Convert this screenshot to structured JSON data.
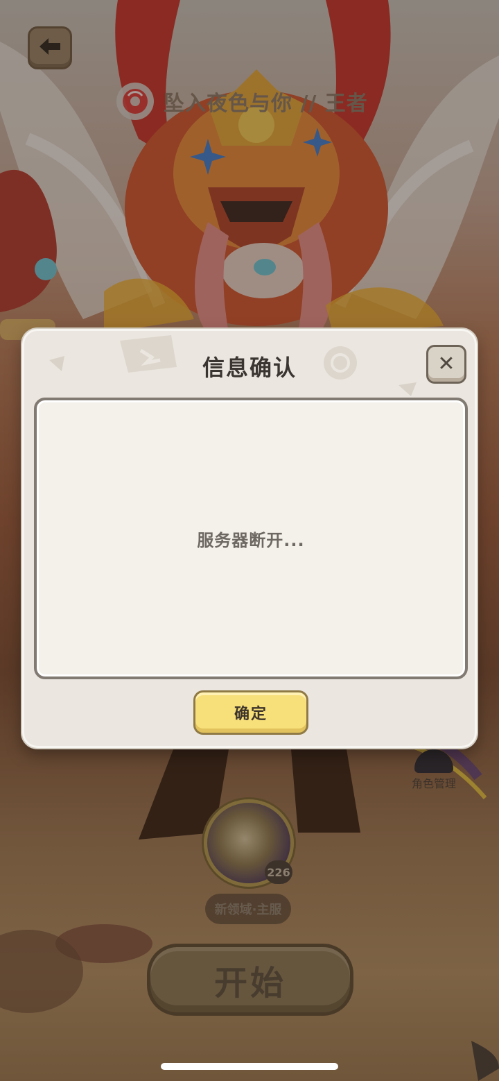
{
  "background": {
    "song_title": "坠入夜色与你 // 王者",
    "role_management_label": "角色管理",
    "avatar_level": "226",
    "server_name": "新领域·主服",
    "start_label": "开始"
  },
  "dialog": {
    "title": "信息确认",
    "message": "服务器断开...",
    "confirm_label": "确定",
    "close_glyph": "✕"
  },
  "colors": {
    "dialog_bg": "#ebe6df",
    "confirm_button": "#f7df7a",
    "scene_overlay": "rgba(40,30,20,0.38)"
  },
  "icons": {
    "back": "arrow-left-icon",
    "music": "music-disc-icon",
    "close": "close-icon"
  }
}
